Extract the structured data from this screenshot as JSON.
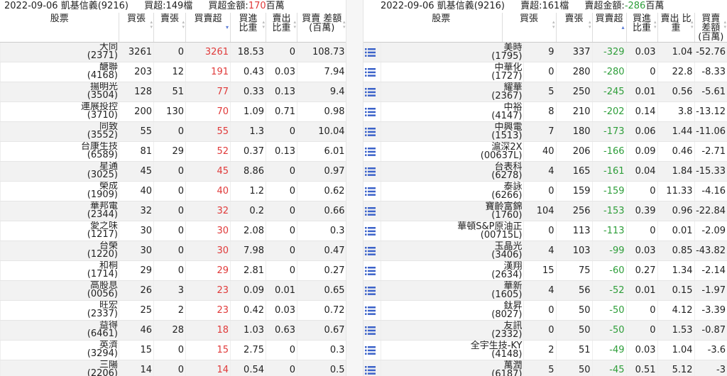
{
  "left": {
    "date": "2022-09-06",
    "broker": "凱基信義(9216)",
    "count_label": "買超:149檔",
    "amount_label": "買超金額:",
    "amount_value": "170",
    "amount_unit": "百萬",
    "headers": {
      "stock": "股票",
      "buy": "買張",
      "sell": "賣張",
      "net": "買賣超",
      "buy_ratio": "買進 比重",
      "sell_ratio": "賣出 比重",
      "amount": "買賣 差額 (百萬)"
    },
    "rows": [
      {
        "name": "大同",
        "code": "(2371)",
        "buy": "3261",
        "sell": "0",
        "net": "3261",
        "br": "18.53",
        "sr": "0",
        "amt": "108.73"
      },
      {
        "name": "醣聯",
        "code": "(4168)",
        "buy": "203",
        "sell": "12",
        "net": "191",
        "br": "0.43",
        "sr": "0.03",
        "amt": "7.94"
      },
      {
        "name": "揚明光",
        "code": "(3504)",
        "buy": "128",
        "sell": "51",
        "net": "77",
        "br": "0.33",
        "sr": "0.13",
        "amt": "9.4"
      },
      {
        "name": "連展投控",
        "code": "(3710)",
        "buy": "200",
        "sell": "130",
        "net": "70",
        "br": "1.09",
        "sr": "0.71",
        "amt": "0.98"
      },
      {
        "name": "同致",
        "code": "(3552)",
        "buy": "55",
        "sell": "0",
        "net": "55",
        "br": "1.3",
        "sr": "0",
        "amt": "10.04"
      },
      {
        "name": "台康生技",
        "code": "(6589)",
        "buy": "81",
        "sell": "29",
        "net": "52",
        "br": "0.37",
        "sr": "0.13",
        "amt": "6.01"
      },
      {
        "name": "星通",
        "code": "(3025)",
        "buy": "45",
        "sell": "0",
        "net": "45",
        "br": "8.86",
        "sr": "0",
        "amt": "0.97"
      },
      {
        "name": "榮成",
        "code": "(1909)",
        "buy": "40",
        "sell": "0",
        "net": "40",
        "br": "1.2",
        "sr": "0",
        "amt": "0.62"
      },
      {
        "name": "華邦電",
        "code": "(2344)",
        "buy": "32",
        "sell": "0",
        "net": "32",
        "br": "0.2",
        "sr": "0",
        "amt": "0.66"
      },
      {
        "name": "愛之味",
        "code": "(1217)",
        "buy": "30",
        "sell": "0",
        "net": "30",
        "br": "2.08",
        "sr": "0",
        "amt": "0.3"
      },
      {
        "name": "台榮",
        "code": "(1220)",
        "buy": "30",
        "sell": "0",
        "net": "30",
        "br": "7.98",
        "sr": "0",
        "amt": "0.47"
      },
      {
        "name": "和桐",
        "code": "(1714)",
        "buy": "29",
        "sell": "0",
        "net": "29",
        "br": "2.81",
        "sr": "0",
        "amt": "0.27"
      },
      {
        "name": "高股息",
        "code": "(0056)",
        "buy": "26",
        "sell": "3",
        "net": "23",
        "br": "0.09",
        "sr": "0.01",
        "amt": "0.65"
      },
      {
        "name": "旺宏",
        "code": "(2337)",
        "buy": "25",
        "sell": "2",
        "net": "23",
        "br": "0.42",
        "sr": "0.03",
        "amt": "0.72"
      },
      {
        "name": "益得",
        "code": "(6461)",
        "buy": "46",
        "sell": "28",
        "net": "18",
        "br": "1.03",
        "sr": "0.63",
        "amt": "0.67"
      },
      {
        "name": "英濟",
        "code": "(3294)",
        "buy": "15",
        "sell": "0",
        "net": "15",
        "br": "2.75",
        "sr": "0",
        "amt": "0.3"
      },
      {
        "name": "三陽",
        "code": "(2206)",
        "buy": "14",
        "sell": "0",
        "net": "14",
        "br": "0.54",
        "sr": "0",
        "amt": "0.5"
      }
    ]
  },
  "right": {
    "date": "2022-09-06",
    "broker": "凱基信義(9216)",
    "count_label": "賣超:161檔",
    "amount_label": "賣超金額:",
    "amount_value": "-286",
    "amount_unit": "百萬",
    "headers": {
      "stock": "股票",
      "buy": "買張",
      "sell": "賣張",
      "net": "買賣超",
      "buy_ratio": "買進 比重",
      "sell_ratio": "賣出 比重",
      "amount": "買賣 差額 (百萬)"
    },
    "rows": [
      {
        "name": "美時",
        "code": "(1795)",
        "buy": "9",
        "sell": "337",
        "net": "-329",
        "br": "0.03",
        "sr": "1.04",
        "amt": "-52.76"
      },
      {
        "name": "中華化",
        "code": "(1727)",
        "buy": "0",
        "sell": "280",
        "net": "-280",
        "br": "0",
        "sr": "22.8",
        "amt": "-8.33"
      },
      {
        "name": "耀華",
        "code": "(2367)",
        "buy": "5",
        "sell": "250",
        "net": "-245",
        "br": "0.01",
        "sr": "0.56",
        "amt": "-5.61"
      },
      {
        "name": "中裕",
        "code": "(4147)",
        "buy": "8",
        "sell": "210",
        "net": "-202",
        "br": "0.14",
        "sr": "3.8",
        "amt": "-13.12"
      },
      {
        "name": "中興電",
        "code": "(1513)",
        "buy": "7",
        "sell": "180",
        "net": "-173",
        "br": "0.06",
        "sr": "1.44",
        "amt": "-11.06"
      },
      {
        "name": "滬深2X",
        "code": "(00637L)",
        "buy": "40",
        "sell": "206",
        "net": "-166",
        "br": "0.09",
        "sr": "0.46",
        "amt": "-2.71"
      },
      {
        "name": "台表科",
        "code": "(6278)",
        "buy": "4",
        "sell": "165",
        "net": "-161",
        "br": "0.04",
        "sr": "1.84",
        "amt": "-15.33"
      },
      {
        "name": "泰詠",
        "code": "(6266)",
        "buy": "0",
        "sell": "159",
        "net": "-159",
        "br": "0",
        "sr": "11.33",
        "amt": "-4.16"
      },
      {
        "name": "寶齡富錦",
        "code": "(1760)",
        "buy": "104",
        "sell": "256",
        "net": "-153",
        "br": "0.39",
        "sr": "0.96",
        "amt": "-22.84"
      },
      {
        "name": "華頓S&P原油正",
        "code": "(00715L)",
        "buy": "0",
        "sell": "113",
        "net": "-113",
        "br": "0",
        "sr": "0.01",
        "amt": "-2.09"
      },
      {
        "name": "玉晶光",
        "code": "(3406)",
        "buy": "4",
        "sell": "103",
        "net": "-99",
        "br": "0.03",
        "sr": "0.85",
        "amt": "-43.82"
      },
      {
        "name": "漢翔",
        "code": "(2634)",
        "buy": "15",
        "sell": "75",
        "net": "-60",
        "br": "0.27",
        "sr": "1.34",
        "amt": "-2.14"
      },
      {
        "name": "華新",
        "code": "(1605)",
        "buy": "4",
        "sell": "56",
        "net": "-52",
        "br": "0.01",
        "sr": "0.15",
        "amt": "-1.97"
      },
      {
        "name": "鈦昇",
        "code": "(8027)",
        "buy": "0",
        "sell": "50",
        "net": "-50",
        "br": "0",
        "sr": "4.12",
        "amt": "-3.39"
      },
      {
        "name": "友訊",
        "code": "(2332)",
        "buy": "0",
        "sell": "50",
        "net": "-50",
        "br": "0",
        "sr": "1.53",
        "amt": "-0.87"
      },
      {
        "name": "全宇生技-KY",
        "code": "(4148)",
        "buy": "2",
        "sell": "51",
        "net": "-49",
        "br": "0.03",
        "sr": "1.04",
        "amt": "-3.6"
      },
      {
        "name": "萬潤",
        "code": "(6187)",
        "buy": "5",
        "sell": "50",
        "net": "-45",
        "br": "0.51",
        "sr": "5.12",
        "amt": "-3"
      }
    ]
  },
  "icon": "list-icon",
  "colors": {
    "positive": "#e03a3a",
    "negative": "#2e9e3a",
    "icon": "#3b62c9"
  }
}
